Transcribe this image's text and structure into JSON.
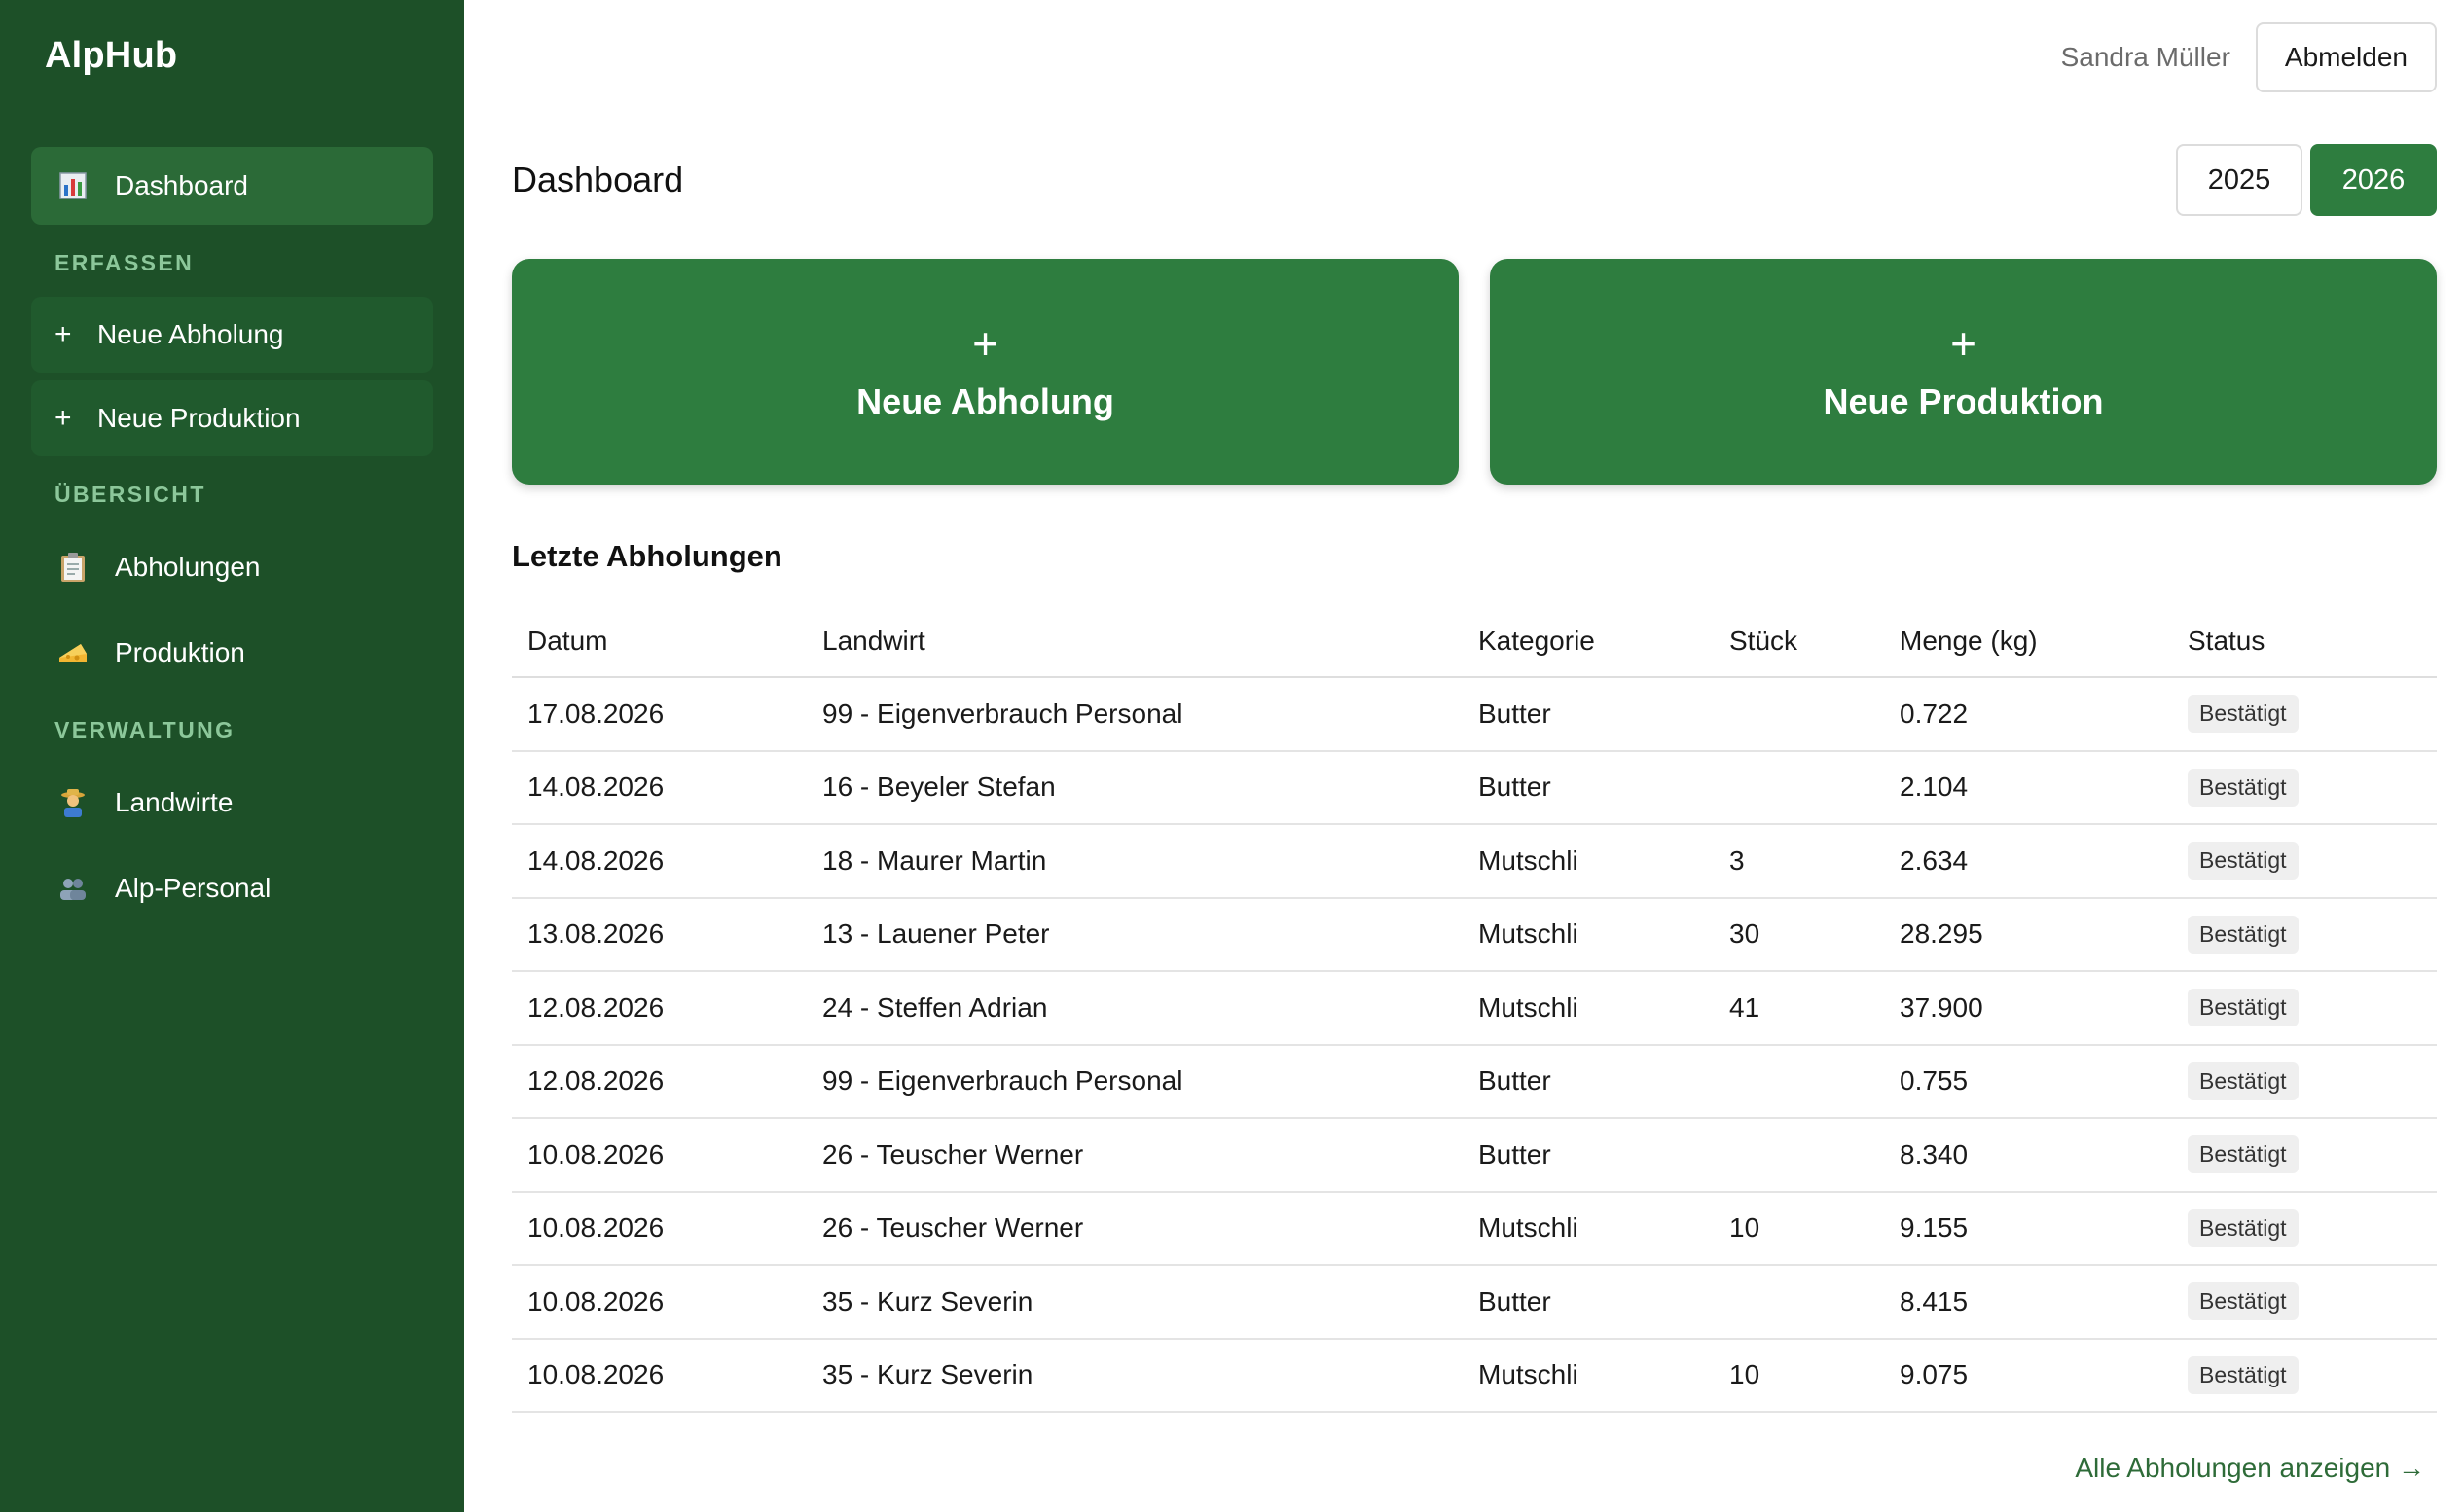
{
  "app": {
    "brand": "AlpHub"
  },
  "colors": {
    "sidebar": "#1d5028",
    "accent": "#2e7d3f",
    "link": "#2e6b38"
  },
  "sidebar": {
    "dashboard": {
      "label": "Dashboard",
      "icon": "bar-chart-icon"
    },
    "sections": {
      "erfassen": "ERFASSEN",
      "uebersicht": "ÜBERSICHT",
      "verwaltung": "VERWALTUNG"
    },
    "quick": [
      {
        "label": "Neue Abholung",
        "icon": "plus-icon"
      },
      {
        "label": "Neue Produktion",
        "icon": "plus-icon"
      }
    ],
    "overview": [
      {
        "label": "Abholungen",
        "icon": "clipboard-icon"
      },
      {
        "label": "Produktion",
        "icon": "cheese-icon"
      }
    ],
    "admin": [
      {
        "label": "Landwirte",
        "icon": "farmer-icon"
      },
      {
        "label": "Alp-Personal",
        "icon": "people-icon"
      }
    ]
  },
  "header": {
    "user": "Sandra Müller",
    "logout": "Abmelden"
  },
  "page": {
    "title": "Dashboard",
    "years": [
      "2025",
      "2026"
    ],
    "selected_year": "2026"
  },
  "actions": {
    "plus": "+",
    "new_pickup": "Neue Abholung",
    "new_production": "Neue Produktion"
  },
  "table": {
    "title": "Letzte Abholungen",
    "columns": [
      "Datum",
      "Landwirt",
      "Kategorie",
      "Stück",
      "Menge (kg)",
      "Status"
    ],
    "rows": [
      [
        "17.08.2026",
        "99 - Eigenverbrauch Personal",
        "Butter",
        "",
        "0.722",
        "Bestätigt"
      ],
      [
        "14.08.2026",
        "16 - Beyeler Stefan",
        "Butter",
        "",
        "2.104",
        "Bestätigt"
      ],
      [
        "14.08.2026",
        "18 - Maurer Martin",
        "Mutschli",
        "3",
        "2.634",
        "Bestätigt"
      ],
      [
        "13.08.2026",
        "13 - Lauener Peter",
        "Mutschli",
        "30",
        "28.295",
        "Bestätigt"
      ],
      [
        "12.08.2026",
        "24 - Steffen Adrian",
        "Mutschli",
        "41",
        "37.900",
        "Bestätigt"
      ],
      [
        "12.08.2026",
        "99 - Eigenverbrauch Personal",
        "Butter",
        "",
        "0.755",
        "Bestätigt"
      ],
      [
        "10.08.2026",
        "26 - Teuscher Werner",
        "Butter",
        "",
        "8.340",
        "Bestätigt"
      ],
      [
        "10.08.2026",
        "26 - Teuscher Werner",
        "Mutschli",
        "10",
        "9.155",
        "Bestätigt"
      ],
      [
        "10.08.2026",
        "35 - Kurz Severin",
        "Butter",
        "",
        "8.415",
        "Bestätigt"
      ],
      [
        "10.08.2026",
        "35 - Kurz Severin",
        "Mutschli",
        "10",
        "9.075",
        "Bestätigt"
      ]
    ],
    "footer_link": "Alle Abholungen anzeigen →"
  }
}
